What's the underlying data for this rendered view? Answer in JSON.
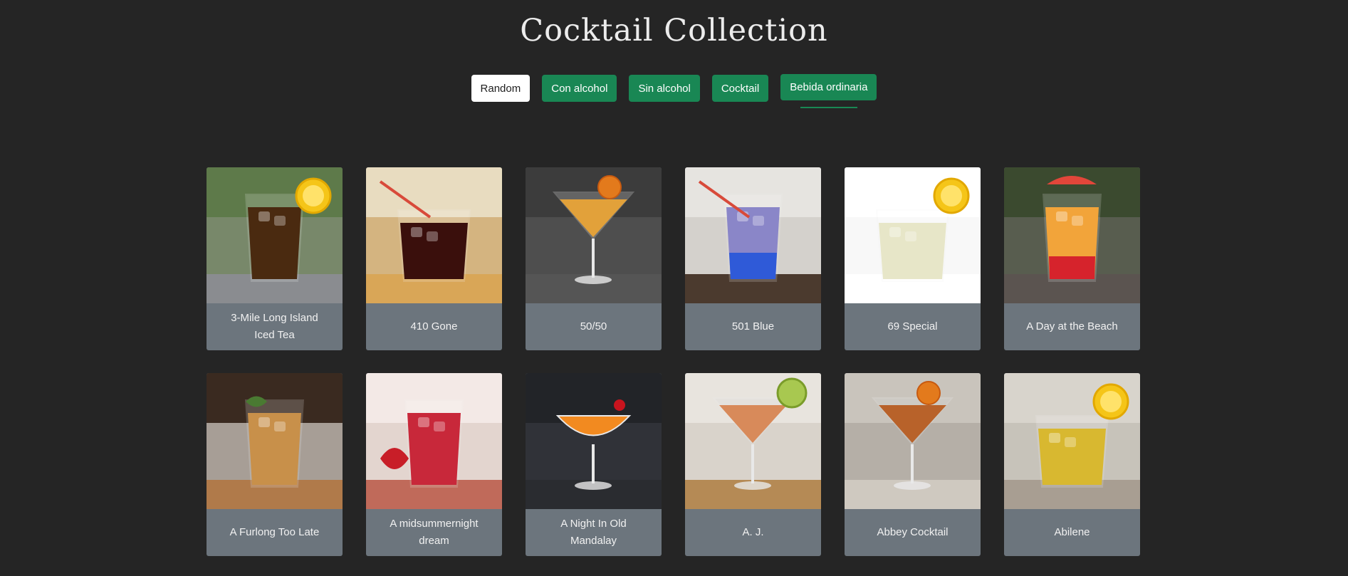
{
  "header": {
    "title": "Cocktail Collection"
  },
  "filters": [
    {
      "label": "Random",
      "style": "white"
    },
    {
      "label": "Con alcohol",
      "style": "green"
    },
    {
      "label": "Sin alcohol",
      "style": "green"
    },
    {
      "label": "Cocktail",
      "style": "green"
    },
    {
      "label": "Bebida ordinaria",
      "style": "green",
      "active": true
    }
  ],
  "colors": {
    "background": "#252525",
    "accent": "#198754",
    "card_footer": "#6c757d"
  },
  "cocktails": [
    {
      "name": "3-Mile Long Island Iced Tea",
      "drink": "long-glass-dark-tea-lemon",
      "bg1": "#5e7a4a",
      "bg2": "#8a9180",
      "table": "#8a8c90",
      "liquid": "#4a2a10",
      "garnish": "lemon"
    },
    {
      "name": "410 Gone",
      "drink": "rocks-glass-cola-straws",
      "bg1": "#e8dcc0",
      "bg2": "#c79a55",
      "table": "#d9a657",
      "liquid": "#3a0f0c",
      "garnish": "straw"
    },
    {
      "name": "50/50",
      "drink": "martini-glass-orange",
      "bg1": "#3c3c3c",
      "bg2": "#5a5a5a",
      "table": "#555555",
      "liquid": "#e2a13a",
      "garnish": "orange-slice"
    },
    {
      "name": "501 Blue",
      "drink": "tall-glass-purple-blue",
      "bg1": "#e6e4e0",
      "bg2": "#c8c4be",
      "table": "#4b3a2e",
      "liquid": "#8a86c8",
      "garnish": "straw"
    },
    {
      "name": "69 Special",
      "drink": "rocks-glass-clear-lemon",
      "bg1": "#ffffff",
      "bg2": "#f4f4f4",
      "table": "#ffffff",
      "liquid": "#e7e6c8",
      "garnish": "lemon"
    },
    {
      "name": "A Day at the Beach",
      "drink": "tall-glass-sunrise",
      "bg1": "#3b4a2f",
      "bg2": "#6c6a66",
      "table": "#5b5450",
      "liquid": "#f2a43a",
      "garnish": "grapefruit"
    },
    {
      "name": "A Furlong Too Late",
      "drink": "highball-amber-mint",
      "bg1": "#3a2a20",
      "bg2": "#f0ece6",
      "table": "#b07a4a",
      "liquid": "#c8904a",
      "garnish": "mint"
    },
    {
      "name": "A midsummernight dream",
      "drink": "tall-glass-red-strawberry",
      "bg1": "#f3e9e6",
      "bg2": "#d8c8c0",
      "table": "#c06a5a",
      "liquid": "#c8283a",
      "garnish": "strawberry"
    },
    {
      "name": "A Night In Old Mandalay",
      "drink": "coupe-orange-cherry",
      "bg1": "#222428",
      "bg2": "#3a3c42",
      "table": "#2a2c30",
      "liquid": "#f28a20",
      "garnish": "cherry"
    },
    {
      "name": "A. J.",
      "drink": "martini-pink-grapefruit",
      "bg1": "#e8e4de",
      "bg2": "#cfc8be",
      "table": "#b58a55",
      "liquid": "#d88a5a",
      "garnish": "lime"
    },
    {
      "name": "Abbey Cocktail",
      "drink": "martini-amber-orange",
      "bg1": "#c9c4bc",
      "bg2": "#a8a29a",
      "table": "#cfc9c0",
      "liquid": "#b8622a",
      "garnish": "orange"
    },
    {
      "name": "Abilene",
      "drink": "rocks-yellow-lemon",
      "bg1": "#d8d4cc",
      "bg2": "#bdb8ae",
      "table": "#a89e92",
      "liquid": "#d8b830",
      "garnish": "lemon"
    }
  ]
}
